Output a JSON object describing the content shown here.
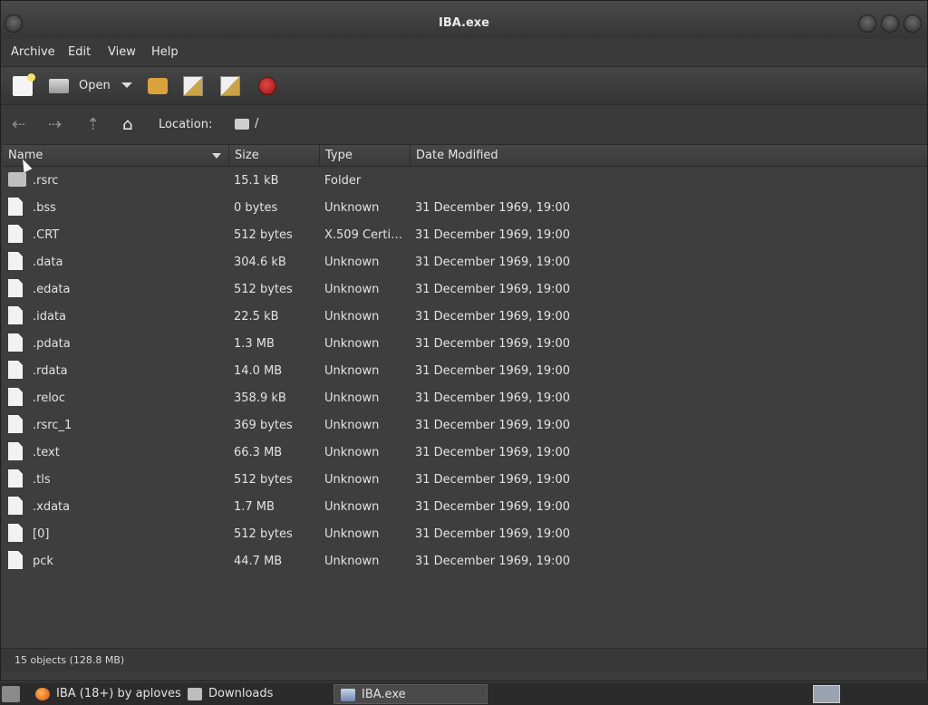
{
  "window": {
    "title": "IBA.exe"
  },
  "menu": [
    "Archive",
    "Edit",
    "View",
    "Help"
  ],
  "toolbar": {
    "open_label": "Open"
  },
  "location": {
    "label": "Location:",
    "path": "/"
  },
  "columns": {
    "name": "Name",
    "size": "Size",
    "type": "Type",
    "date": "Date Modified"
  },
  "files": [
    {
      "name": ".rsrc",
      "size": "15.1 kB",
      "type": "Folder",
      "date": "",
      "icon": "folder-icon"
    },
    {
      "name": ".bss",
      "size": "0 bytes",
      "type": "Unknown",
      "date": "31 December 1969, 19:00",
      "icon": "file-icon"
    },
    {
      "name": ".CRT",
      "size": "512 bytes",
      "type": "X.509 Certifi…",
      "date": "31 December 1969, 19:00",
      "icon": "file-icon"
    },
    {
      "name": ".data",
      "size": "304.6 kB",
      "type": "Unknown",
      "date": "31 December 1969, 19:00",
      "icon": "file-icon"
    },
    {
      "name": ".edata",
      "size": "512 bytes",
      "type": "Unknown",
      "date": "31 December 1969, 19:00",
      "icon": "file-icon"
    },
    {
      "name": ".idata",
      "size": "22.5 kB",
      "type": "Unknown",
      "date": "31 December 1969, 19:00",
      "icon": "file-icon"
    },
    {
      "name": ".pdata",
      "size": "1.3 MB",
      "type": "Unknown",
      "date": "31 December 1969, 19:00",
      "icon": "file-icon"
    },
    {
      "name": ".rdata",
      "size": "14.0 MB",
      "type": "Unknown",
      "date": "31 December 1969, 19:00",
      "icon": "file-icon"
    },
    {
      "name": ".reloc",
      "size": "358.9 kB",
      "type": "Unknown",
      "date": "31 December 1969, 19:00",
      "icon": "file-icon"
    },
    {
      "name": ".rsrc_1",
      "size": "369 bytes",
      "type": "Unknown",
      "date": "31 December 1969, 19:00",
      "icon": "file-icon"
    },
    {
      "name": ".text",
      "size": "66.3 MB",
      "type": "Unknown",
      "date": "31 December 1969, 19:00",
      "icon": "file-icon"
    },
    {
      "name": ".tls",
      "size": "512 bytes",
      "type": "Unknown",
      "date": "31 December 1969, 19:00",
      "icon": "file-icon"
    },
    {
      "name": ".xdata",
      "size": "1.7 MB",
      "type": "Unknown",
      "date": "31 December 1969, 19:00",
      "icon": "file-icon"
    },
    {
      "name": "[0]",
      "size": "512 bytes",
      "type": "Unknown",
      "date": "31 December 1969, 19:00",
      "icon": "file-icon"
    },
    {
      "name": "pck",
      "size": "44.7 MB",
      "type": "Unknown",
      "date": "31 December 1969, 19:00",
      "icon": "file-icon"
    }
  ],
  "status": {
    "text": "15 objects (128.8 MB)"
  },
  "taskbar": {
    "tasks": [
      {
        "label": "IBA (18+) by aploves…",
        "icon": "firefox-icon"
      },
      {
        "label": "Downloads",
        "icon": "folder-icon"
      },
      {
        "label": "IBA.exe",
        "icon": "archive-manager-icon"
      }
    ]
  }
}
